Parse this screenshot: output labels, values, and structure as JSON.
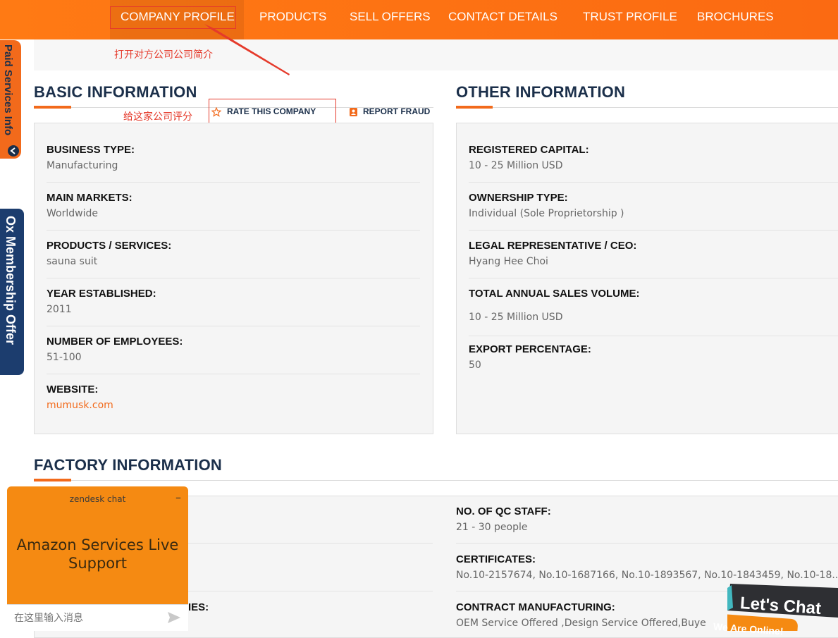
{
  "nav": {
    "items": [
      {
        "label": "COMPANY PROFILE",
        "active": true
      },
      {
        "label": "PRODUCTS"
      },
      {
        "label": "SELL OFFERS"
      },
      {
        "label": "CONTACT DETAILS"
      },
      {
        "label": "TRUST PROFILE"
      },
      {
        "label": "BROCHURES"
      }
    ]
  },
  "annotations": {
    "open_profile": "打开对方公司公司简介",
    "rate_company": "给这家公司评分"
  },
  "side_tabs": {
    "paid": "Paid Services Info",
    "membership": "Ox Membership Offer"
  },
  "basic": {
    "title": "BASIC INFORMATION",
    "rate_label": "RATE THIS COMPANY",
    "report_label": "REPORT FRAUD",
    "fields": [
      {
        "label": "BUSINESS TYPE:",
        "value": "Manufacturing"
      },
      {
        "label": "MAIN MARKETS:",
        "value": "Worldwide"
      },
      {
        "label": "PRODUCTS / SERVICES:",
        "value": "sauna suit"
      },
      {
        "label": "YEAR ESTABLISHED:",
        "value": "2011"
      },
      {
        "label": "NUMBER OF EMPLOYEES:",
        "value": "51-100"
      },
      {
        "label": "WEBSITE:",
        "value": "mumusk.com"
      }
    ]
  },
  "other": {
    "title": "OTHER INFORMATION",
    "fields": [
      {
        "label": "REGISTERED CAPITAL:",
        "value": "10 - 25 Million USD"
      },
      {
        "label": "OWNERSHIP TYPE:",
        "value": "Individual (Sole Proprietorship )"
      },
      {
        "label": "LEGAL REPRESENTATIVE / CEO:",
        "value": "Hyang Hee Choi"
      },
      {
        "label": "TOTAL ANNUAL SALES VOLUME:",
        "value": "10 - 25 Million USD"
      },
      {
        "label": "EXPORT PERCENTAGE:",
        "value": "50"
      }
    ]
  },
  "factory": {
    "title": "FACTORY INFORMATION",
    "left_partial_label": "IES:",
    "fields": [
      {
        "label": "NO. OF QC STAFF:",
        "value": "21 - 30 people"
      },
      {
        "label": "CERTIFICATES:",
        "value": "No.10-2157674, No.10-1687166, No.10-1893567, No.10-1843459, No.10-18..."
      },
      {
        "label": "CONTRACT MANUFACTURING:",
        "value": "OEM Service Offered ,Design Service Offered,Buye"
      }
    ]
  },
  "chat": {
    "brand": "zendesk chat",
    "minimize": "–",
    "headline": "Amazon Services Live Support",
    "placeholder": "在这里输入消息"
  },
  "letschat": {
    "label": "Let's Chat",
    "status": "We Are Online!"
  },
  "colors": {
    "brand_orange": "#f26a1b",
    "nav_orange": "#ff7a14",
    "title_navy": "#1b2f4a",
    "annotation_red": "#e53a2b",
    "chat_orange": "#f58a12",
    "side_blue": "#1c3d6e"
  }
}
